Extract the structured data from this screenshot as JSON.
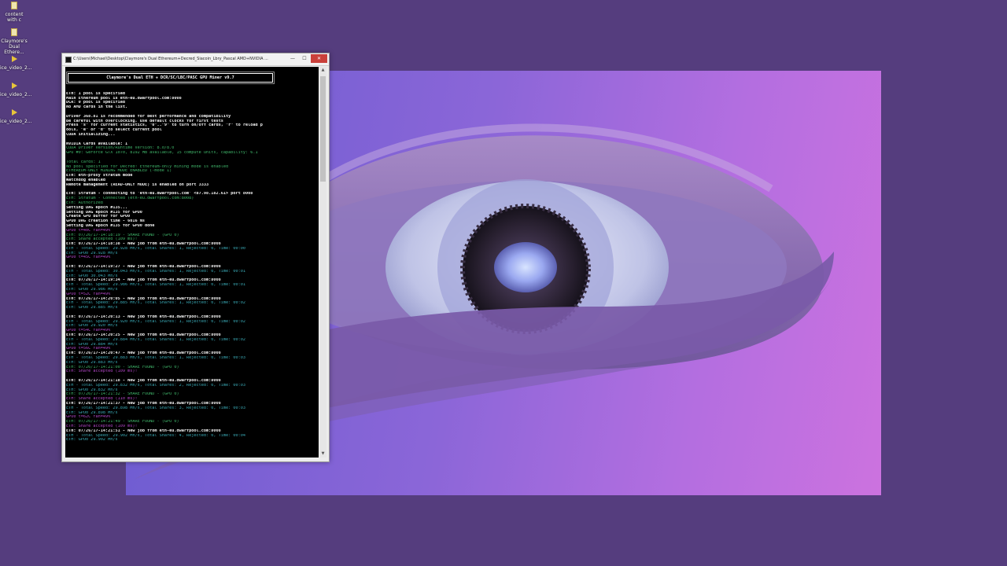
{
  "desktop": {
    "icons": [
      {
        "label": "content with c",
        "icon": "file-icon"
      },
      {
        "label": "Claymore's Dual Ethere...",
        "icon": "file-icon"
      },
      {
        "label": "ice_video_2...",
        "icon": "video-file-icon"
      },
      {
        "label": "ice_video_2...",
        "icon": "video-file-icon"
      },
      {
        "label": "ice_video_2...",
        "icon": "video-file-icon"
      }
    ]
  },
  "console": {
    "title": "C:\\Users\\Michael\\Desktop\\Claymore's Dual Ethereum+Decred_Siacoin_Lbry_Pascal AMD+NVIDIA ...",
    "minimize_label": "—",
    "maximize_label": "☐",
    "close_label": "✕",
    "banner": "Claymore's Dual ETH + DCR/SC/LBC/PASC GPU Miner v9.7",
    "lines": [
      {
        "t": "",
        "c": "w"
      },
      {
        "t": "ETH: 1 pool is specified",
        "c": "w"
      },
      {
        "t": "Main Ethereum pool is eth-eu.dwarfpool.com:8008",
        "c": "w"
      },
      {
        "t": "DCR: 0 pool is specified",
        "c": "w"
      },
      {
        "t": "No AMD cards in the list.",
        "c": "w"
      },
      {
        "t": "",
        "c": "w"
      },
      {
        "t": "Driver 368.81 is recommended for best performance and compatibility",
        "c": "w"
      },
      {
        "t": "Be careful with overclocking, use default clocks for first tests",
        "c": "w"
      },
      {
        "t": "Press \"s\" for current statistics, \"0\"..\"9\" to turn on/off cards, \"r\" to reload p",
        "c": "w"
      },
      {
        "t": "ools, \"e\" or \"d\" to select current pool",
        "c": "w"
      },
      {
        "t": "CUDA initializing...",
        "c": "w"
      },
      {
        "t": "",
        "c": "w"
      },
      {
        "t": "NVIDIA Cards available: 1",
        "c": "w"
      },
      {
        "t": "CUDA Driver Version/Runtime Version: 8.0/8.0",
        "c": "g"
      },
      {
        "t": "GPU #0: GeForce GTX 1070, 8192 MB available, 15 compute units, capability: 6.1",
        "c": "g"
      },
      {
        "t": "",
        "c": "w"
      },
      {
        "t": "Total cards: 1",
        "c": "g"
      },
      {
        "t": "No pool specified for Decred! Ethereum-only mining mode is enabled",
        "c": "g"
      },
      {
        "t": "ETHEREUM-ONLY MINING MODE ENABLED (-mode 1)",
        "c": "g"
      },
      {
        "t": "ETH: eth-proxy stratum mode",
        "c": "w"
      },
      {
        "t": "Watchdog enabled",
        "c": "w"
      },
      {
        "t": "Remote management (READ-ONLY MODE) is enabled on port 3333",
        "c": "w"
      },
      {
        "t": "",
        "c": "w"
      },
      {
        "t": "ETH: Stratum - connecting to 'eth-eu.dwarfpool.com' <87.98.182.61> port 8008",
        "c": "w"
      },
      {
        "t": "ETH: Stratum - Connected (eth-eu.dwarfpool.com:8008)",
        "c": "g"
      },
      {
        "t": "ETH: Authorized",
        "c": "g"
      },
      {
        "t": "Setting DAG epoch #135...",
        "c": "w"
      },
      {
        "t": "Setting DAG epoch #135 for GPU0",
        "c": "w"
      },
      {
        "t": "Create GPU buffer for GPU0",
        "c": "w"
      },
      {
        "t": "GPU0 DAG creation time - 6016 ms",
        "c": "w"
      },
      {
        "t": "Setting DAG epoch #135 for GPU0 done",
        "c": "w"
      },
      {
        "t": "GPU0 t=40C fan=49%",
        "c": "m"
      },
      {
        "t": "ETH: 07/26/17-14:18:19 - SHARE FOUND - (GPU 0)",
        "c": "g"
      },
      {
        "t": "ETH: Share accepted (109 ms)!",
        "c": "g"
      },
      {
        "t": "ETH: 07/26/17-14:18:38 - New job from eth-eu.dwarfpool.com:8008",
        "c": "w"
      },
      {
        "t": "ETH - Total Speed: 29.928 Mh/s, Total Shares: 1, Rejected: 0, Time: 00:00",
        "c": "c"
      },
      {
        "t": "ETH: GPU0 29.928 Mh/s",
        "c": "c"
      },
      {
        "t": "GPU0 t=45C fan=49%",
        "c": "m"
      },
      {
        "t": "",
        "c": "w"
      },
      {
        "t": "ETH: 07/26/17-14:19:27 - New job from eth-eu.dwarfpool.com:8008",
        "c": "w"
      },
      {
        "t": "ETH - Total Speed: 30.043 Mh/s, Total Shares: 1, Rejected: 0, Time: 00:01",
        "c": "c"
      },
      {
        "t": "ETH: GPU0 30.043 Mh/s",
        "c": "c"
      },
      {
        "t": "ETH: 07/26/17-14:19:34 - New job from eth-eu.dwarfpool.com:8008",
        "c": "w"
      },
      {
        "t": "ETH - Total Speed: 29.986 Mh/s, Total Shares: 1, Rejected: 0, Time: 00:01",
        "c": "c"
      },
      {
        "t": "ETH: GPU0 29.986 Mh/s",
        "c": "c"
      },
      {
        "t": "GPU0 t=52C fan=49%",
        "c": "m"
      },
      {
        "t": "ETH: 07/26/17-14:20:05 - New job from eth-eu.dwarfpool.com:8008",
        "c": "w"
      },
      {
        "t": "ETH - Total Speed: 29.885 Mh/s, Total Shares: 1, Rejected: 0, Time: 00:02",
        "c": "c"
      },
      {
        "t": "ETH: GPU0 29.885 Mh/s",
        "c": "c"
      },
      {
        "t": "",
        "c": "w"
      },
      {
        "t": "ETH: 07/26/17-14:20:13 - New job from eth-eu.dwarfpool.com:8008",
        "c": "w"
      },
      {
        "t": "ETH - Total Speed: 29.920 Mh/s, Total Shares: 1, Rejected: 0, Time: 00:02",
        "c": "c"
      },
      {
        "t": "ETH: GPU0 29.920 Mh/s",
        "c": "c"
      },
      {
        "t": "GPU0 t=54C fan=49%",
        "c": "m"
      },
      {
        "t": "ETH: 07/26/17-14:20:25 - New job from eth-eu.dwarfpool.com:8008",
        "c": "w"
      },
      {
        "t": "ETH - Total Speed: 29.884 Mh/s, Total Shares: 1, Rejected: 0, Time: 00:02",
        "c": "c"
      },
      {
        "t": "ETH: GPU0 29.884 Mh/s",
        "c": "c"
      },
      {
        "t": "GPU0 t=56C fan=49%",
        "c": "m"
      },
      {
        "t": "ETH: 07/26/17-14:20:47 - New job from eth-eu.dwarfpool.com:8008",
        "c": "w"
      },
      {
        "t": "ETH - Total Speed: 29.883 Mh/s, Total Shares: 1, Rejected: 0, Time: 00:03",
        "c": "c"
      },
      {
        "t": "ETH: GPU0 29.883 Mh/s",
        "c": "c"
      },
      {
        "t": "ETH: 07/26/17-14:21:00 - SHARE FOUND - (GPU 0)",
        "c": "g"
      },
      {
        "t": "ETH: Share accepted (109 ms)!",
        "c": "m"
      },
      {
        "t": "",
        "c": "w"
      },
      {
        "t": "ETH: 07/26/17-14:21:18 - New job from eth-eu.dwarfpool.com:8008",
        "c": "w"
      },
      {
        "t": "ETH - Total Speed: 29.832 Mh/s, Total Shares: 2, Rejected: 0, Time: 00:03",
        "c": "c"
      },
      {
        "t": "ETH: GPU0 29.832 Mh/s",
        "c": "c"
      },
      {
        "t": "ETH: 07/26/17-14:21:32 - SHARE FOUND - (GPU 0)",
        "c": "g"
      },
      {
        "t": "ETH: Share accepted (110 ms)!",
        "c": "m"
      },
      {
        "t": "ETH: 07/26/17-14:21:37 - New job from eth-eu.dwarfpool.com:8008",
        "c": "w"
      },
      {
        "t": "ETH - Total Speed: 29.898 Mh/s, Total Shares: 3, Rejected: 0, Time: 00:03",
        "c": "c"
      },
      {
        "t": "ETH: GPU0 29.898 Mh/s",
        "c": "c"
      },
      {
        "t": "GPU0 t=62C fan=49%",
        "c": "m"
      },
      {
        "t": "ETH: 07/26/17-14:21:49 - SHARE FOUND - (GPU 0)",
        "c": "g"
      },
      {
        "t": "ETH: Share accepted (109 ms)!",
        "c": "m"
      },
      {
        "t": "ETH: 07/26/17-14:21:51 - New job from eth-eu.dwarfpool.com:8008",
        "c": "w"
      },
      {
        "t": "ETH - Total Speed: 29.902 Mh/s, Total Shares: 4, Rejected: 0, Time: 00:04",
        "c": "c"
      },
      {
        "t": "ETH: GPU0 29.902 Mh/s",
        "c": "c"
      }
    ]
  }
}
